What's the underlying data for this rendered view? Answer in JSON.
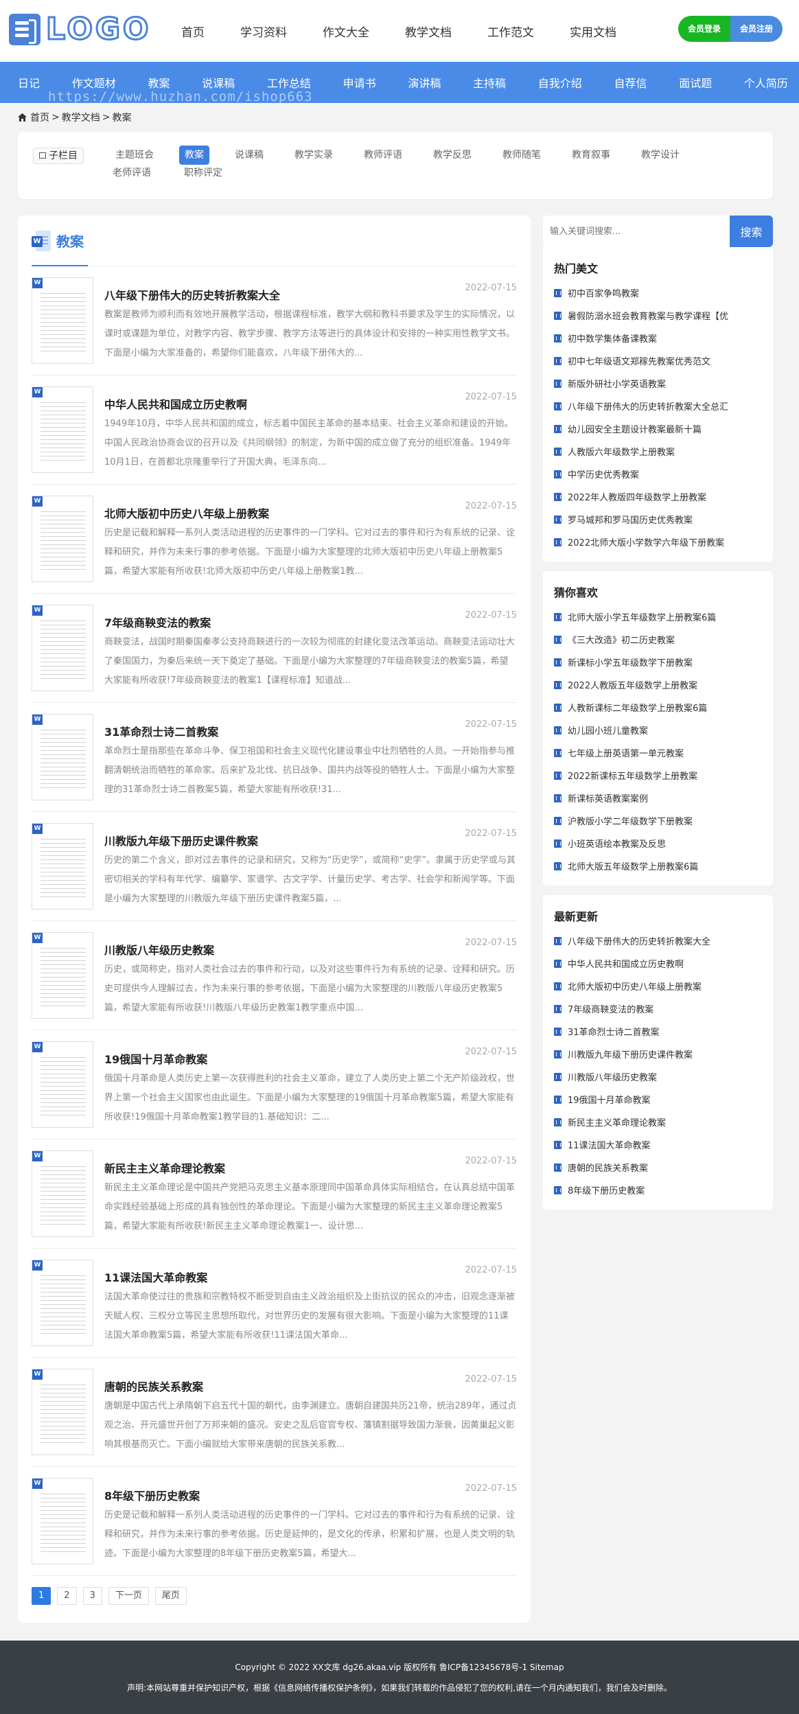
{
  "header": {
    "logo_text": "LOGO",
    "nav": [
      "首页",
      "学习资料",
      "作文大全",
      "教学文档",
      "工作范文",
      "实用文档"
    ],
    "login": "会员登录",
    "register": "会员注册"
  },
  "bluebar": {
    "items": [
      "日记",
      "作文题材",
      "教案",
      "说课稿",
      "工作总结",
      "申请书",
      "演讲稿",
      "主持稿",
      "自我介绍",
      "自荐信",
      "面试题",
      "个人简历"
    ],
    "watermark": "https://www.huzhan.com/ishop663"
  },
  "breadcrumb": {
    "home": "首页",
    "sep": ">",
    "level1": "教学文档",
    "level2": "教案"
  },
  "subcolumn": {
    "label": "子栏目",
    "row1": [
      "主题班会",
      "教案",
      "说课稿",
      "教学实录",
      "教师评语",
      "教学反思",
      "教师随笔",
      "教育叙事",
      "教学设计"
    ],
    "row2": [
      "老师评语",
      "职称评定"
    ],
    "active": "教案"
  },
  "main": {
    "title": "教案",
    "items": [
      {
        "title": "八年级下册伟大的历史转折教案大全",
        "date": "2022-07-15",
        "desc": "教案是教师为顺利而有效地开展教学活动，根据课程标准，教学大纲和教科书要求及学生的实际情况，以课时或课题为单位，对教学内容、教学步骤、教学方法等进行的具体设计和安排的一种实用性教学文书。下面是小编为大家准备的，希望你们能喜欢，八年级下册伟大的..."
      },
      {
        "title": "中华人民共和国成立历史教啊",
        "date": "2022-07-15",
        "desc": "1949年10月，中华人民共和国的成立，标志着中国民主革命的基本结束、社会主义革命和建设的开始。中国人民政治协商会议的召开以及《共同纲领》的制定，为新中国的成立做了充分的组织准备。1949年10月1日，在首都北京隆重举行了开国大典，毛泽东向..."
      },
      {
        "title": "北师大版初中历史八年级上册教案",
        "date": "2022-07-15",
        "desc": "历史是记载和解释一系列人类活动进程的历史事件的一门学科。它对过去的事件和行为有系统的记录、诠释和研究，并作为未来行事的参考依据。下面是小编为大家整理的北师大版初中历史八年级上册教案5篇，希望大家能有所收获!北师大版初中历史八年级上册教案1教..."
      },
      {
        "title": "7年级商鞅变法的教案",
        "date": "2022-07-15",
        "desc": "商鞅变法，战国时期秦国秦孝公支持商鞅进行的一次较为彻底的封建化变法改革运动。商鞅变法运动壮大了秦国国力，为秦后来统一天下奠定了基础。下面是小编为大家整理的7年级商鞅变法的教案5篇，希望大家能有所收获!7年级商鞅变法的教案1【课程标准】知道战..."
      },
      {
        "title": "31革命烈士诗二首教案",
        "date": "2022-07-15",
        "desc": "革命烈士是指那些在革命斗争、保卫祖国和社会主义现代化建设事业中壮烈牺牲的人员。一开始指参与推翻清朝统治而牺牲的革命家。后来扩及北伐、抗日战争、国共内战等役的牺牲人士。下面是小编为大家整理的31革命烈士诗二首教案5篇，希望大家能有所收获!31..."
      },
      {
        "title": "川教版九年级下册历史课件教案",
        "date": "2022-07-15",
        "desc": "历史的第二个含义，即对过去事件的记录和研究，又称为“历史学”，或简称“史学”。隶属于历史学或与其密切相关的学科有年代学、编纂学、家谱学、古文字学、计量历史学、考古学、社会学和新闻学等。下面是小编为大家整理的川教版九年级下册历史课件教案5篇，..."
      },
      {
        "title": "川教版八年级历史教案",
        "date": "2022-07-15",
        "desc": "历史，或简称史，指对人类社会过去的事件和行动，以及对这些事件行为有系统的记录、诠释和研究。历史可提供今人理解过去，作为未来行事的参考依据，下面是小编为大家整理的川教版八年级历史教案5篇，希望大家能有所收获!川教版八年级历史教案1教学重点中国..."
      },
      {
        "title": "19俄国十月革命教案",
        "date": "2022-07-15",
        "desc": "俄国十月革命是人类历史上第一次获得胜利的社会主义革命，建立了人类历史上第二个无产阶级政权，世界上第一个社会主义国家也由此诞生。下面是小编为大家整理的19俄国十月革命教案5篇，希望大家能有所收获!19俄国十月革命教案1教学目的1.基础知识：二..."
      },
      {
        "title": "新民主主义革命理论教案",
        "date": "2022-07-15",
        "desc": "新民主主义革命理论是中国共产党把马克思主义基本原理同中国革命具体实际相结合，在认真总结中国革命实践经验基础上形成的具有独创性的革命理论。下面是小编为大家整理的新民主主义革命理论教案5篇，希望大家能有所收获!新民主主义革命理论教案1一、设计思..."
      },
      {
        "title": "11课法国大革命教案",
        "date": "2022-07-15",
        "desc": "法国大革命使过往的贵族和宗教特权不断受到自由主义政治组织及上街抗议的民众的冲击，旧观念逐渐被天赋人权、三权分立等民主思想所取代，对世界历史的发展有很大影响。下面是小编为大家整理的11课法国大革命教案5篇，希望大家能有所收获!11课法国大革命..."
      },
      {
        "title": "唐朝的民族关系教案",
        "date": "2022-07-15",
        "desc": "唐朝是中国古代上承隋朝下启五代十国的朝代，由李渊建立。唐朝自建国共历21帝，统治289年，通过贞观之治、开元盛世开创了万邦来朝的盛况。安史之乱后宦官专权、藩镇割据导致国力渐衰，因黄巢起义影响其根基而灭亡。下面小编就给大家带来唐朝的民族关系教..."
      },
      {
        "title": "8年级下册历史教案",
        "date": "2022-07-15",
        "desc": "历史是记载和解释一系列人类活动进程的历史事件的一门学科。它对过去的事件和行为有系统的记录、诠释和研究，并作为未来行事的参考依据。历史是延伸的，是文化的传承，积累和扩展，也是人类文明的轨迹。下面是小编为大家整理的8年级下册历史教案5篇，希望大..."
      }
    ],
    "pager": [
      "1",
      "2",
      "3",
      "下一页",
      "尾页"
    ]
  },
  "sidebar": {
    "search_placeholder": "输入关键词搜索...",
    "search_button": "搜索",
    "hot": {
      "title": "热门美文",
      "items": [
        "初中百家争鸣教案",
        "暑假防溺水班会教育教案与教学课程【优",
        "初中数学集体备课教案",
        "初中七年级语文郑稼先教案优秀范文",
        "新版外研社小学英语教案",
        "八年级下册伟大的历史转折教案大全总汇",
        "幼儿园安全主题设计教案最新十篇",
        "人教版六年级数学上册教案",
        "中学历史优秀教案",
        "2022年人教版四年级数学上册教案",
        "罗马城邦和罗马国历史优秀教案",
        "2022北师大版小学数学六年级下册教案"
      ]
    },
    "guess": {
      "title": "猜你喜欢",
      "items": [
        "北师大版小学五年级数学上册教案6篇",
        "《三大改造》初二历史教案",
        "新课标小学五年级数学下册教案",
        "2022人教版五年级数学上册教案",
        "人教新课标二年级数学上册教案6篇",
        "幼儿园小班儿童教案",
        "七年级上册英语第一单元教案",
        "2022新课标五年级数学上册教案",
        "新课标英语教案案例",
        "沪教版小学二年级数学下册教案",
        "小班英语绘本教案及反思",
        "北师大版五年级数学上册教案6篇"
      ]
    },
    "latest": {
      "title": "最新更新",
      "items": [
        "八年级下册伟大的历史转折教案大全",
        "中华人民共和国成立历史教啊",
        "北师大版初中历史八年级上册教案",
        "7年级商鞅变法的教案",
        "31革命烈士诗二首教案",
        "川教版九年级下册历史课件教案",
        "川教版八年级历史教案",
        "19俄国十月革命教案",
        "新民主主义革命理论教案",
        "11课法国大革命教案",
        "唐朝的民族关系教案",
        "8年级下册历史教案"
      ]
    }
  },
  "footer": {
    "line1": "Copyright © 2022 XX文库 dg26.akaa.vip 版权所有 鲁ICP备12345678号-1 Sitemap",
    "line2": "声明:本网站尊重并保护知识产权，根据《信息网络传播权保护条例》，如果我们转载的作品侵犯了您的权利,请在一个月内通知我们，我们会及时删除。"
  },
  "colors": {
    "accent": "#3d7fe0",
    "nav_bar": "#4a8be8",
    "login": "#18b624",
    "register": "#4a8be0",
    "footer": "#3a3f44"
  }
}
